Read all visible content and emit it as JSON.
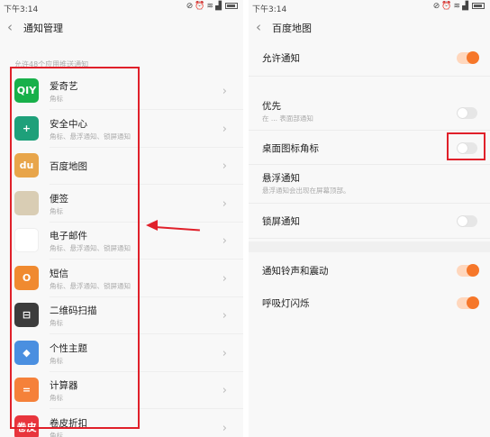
{
  "left": {
    "status_time": "下午3:14",
    "title": "通知管理",
    "section_label": "允许48个应用推送通知",
    "apps": [
      {
        "name": "爱奇艺",
        "sub": "角标",
        "icon": "iqiyi-icon",
        "icon_text": "QIY",
        "color": "#18b04a"
      },
      {
        "name": "安全中心",
        "sub": "角标、悬浮通知、锁屏通知",
        "icon": "shield-icon",
        "icon_text": "+",
        "color": "#1ea07a"
      },
      {
        "name": "百度地图",
        "sub": "",
        "icon": "map-icon",
        "icon_text": "du",
        "color": "#e8a54a"
      },
      {
        "name": "便签",
        "sub": "角标",
        "icon": "notes-icon",
        "icon_text": "",
        "color": "#d9cdb4"
      },
      {
        "name": "电子邮件",
        "sub": "角标、悬浮通知、锁屏通知",
        "icon": "mail-icon",
        "icon_text": "",
        "color": "#ffffff"
      },
      {
        "name": "短信",
        "sub": "角标、悬浮通知、锁屏通知",
        "icon": "message-icon",
        "icon_text": "O",
        "color": "#f08a30"
      },
      {
        "name": "二维码扫描",
        "sub": "角标",
        "icon": "qr-scan-icon",
        "icon_text": "⊟",
        "color": "#3c3c3c"
      },
      {
        "name": "个性主题",
        "sub": "角标",
        "icon": "theme-icon",
        "icon_text": "◆",
        "color": "#4a8fe0"
      },
      {
        "name": "计算器",
        "sub": "角标",
        "icon": "calculator-icon",
        "icon_text": "=",
        "color": "#f5813a"
      },
      {
        "name": "卷皮折扣",
        "sub": "角标",
        "icon": "juanpi-icon",
        "icon_text": "卷皮",
        "color": "#e8353d"
      }
    ]
  },
  "right": {
    "status_time": "下午3:14",
    "title": "百度地图",
    "settings": [
      {
        "name": "允许通知",
        "sub": "",
        "toggle": "on"
      },
      {
        "name": "优先",
        "sub": "在 ... 表面部通知",
        "toggle": "off"
      },
      {
        "name": "桌面图标角标",
        "sub": "",
        "toggle": "off"
      },
      {
        "name": "悬浮通知",
        "sub": "悬浮通知会出现在屏幕顶部。",
        "toggle": "none"
      },
      {
        "name": "锁屏通知",
        "sub": "",
        "toggle": "off"
      },
      {
        "name": "通知铃声和震动",
        "sub": "",
        "toggle": "on"
      },
      {
        "name": "呼吸灯闪烁",
        "sub": "",
        "toggle": "on"
      }
    ]
  },
  "colors": {
    "accent": "#f6772a",
    "annotation": "#e0202a"
  }
}
